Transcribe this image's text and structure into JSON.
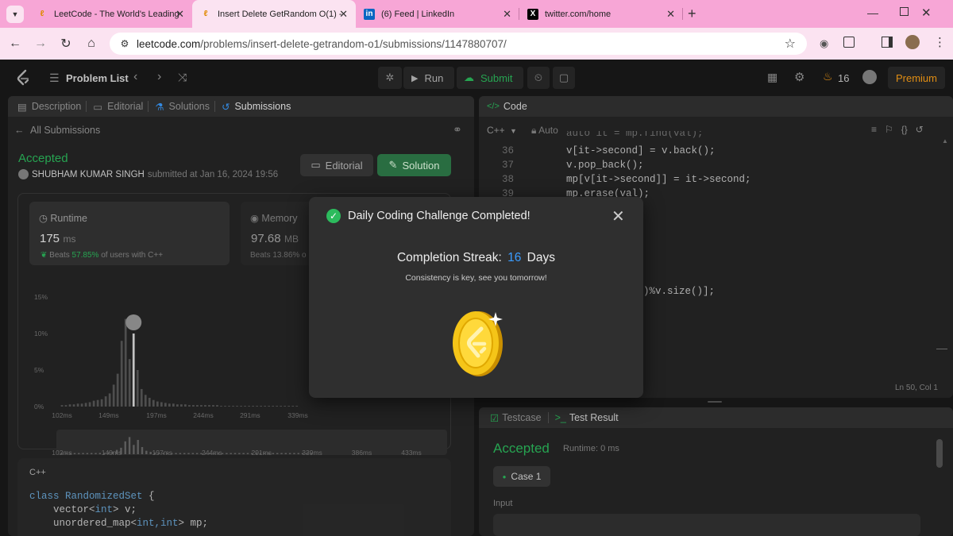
{
  "browser": {
    "tabs": [
      {
        "title": "LeetCode - The World's Leading",
        "favicon": "leetcode-icon"
      },
      {
        "title": "Insert Delete GetRandom O(1) -",
        "favicon": "leetcode-icon"
      },
      {
        "title": "(6) Feed | LinkedIn",
        "favicon": "linkedin-icon",
        "badge": "in"
      },
      {
        "title": "twitter.com/home",
        "favicon": "x-icon",
        "badge": "X"
      }
    ],
    "url_host": "leetcode.com",
    "url_path": "/problems/insert-delete-getrandom-o1/submissions/1147880707/"
  },
  "nav": {
    "problem_list": "Problem List",
    "run": "Run",
    "submit": "Submit",
    "streak_count": "16",
    "premium": "Premium"
  },
  "left": {
    "tabs": [
      "Description",
      "Editorial",
      "Solutions",
      "Submissions"
    ],
    "all_submissions": "All Submissions",
    "status": "Accepted",
    "author": "SHUBHAM KUMAR SINGH",
    "submitted_at": "submitted at Jan 16, 2024 19:56",
    "editorial_btn": "Editorial",
    "solution_btn": "Solution",
    "runtime": {
      "label": "Runtime",
      "value": "175",
      "unit": "ms",
      "beats_prefix": "Beats",
      "beats_value": "57.85%",
      "beats_suffix": "of users with C++"
    },
    "memory": {
      "label": "Memory",
      "value": "97.68",
      "unit": "MB",
      "beats": "Beats 13.86% o"
    },
    "y_ticks": [
      "15%",
      "10%",
      "5%",
      "0%"
    ],
    "x_ticks": [
      "102ms",
      "149ms",
      "197ms",
      "244ms",
      "291ms",
      "339ms"
    ],
    "mini_ticks": [
      "102ms",
      "149ms",
      "197ms",
      "244ms",
      "291ms",
      "339ms",
      "386ms",
      "433ms"
    ],
    "lang": "C++",
    "code": [
      {
        "a": "class ",
        "b": "RandomizedSet",
        "c": " {"
      },
      {
        "a": "    vector<",
        "b": "int",
        "c": "> v;"
      },
      {
        "a": "    unordered_map<",
        "b": "int,int",
        "c": "> mp;"
      }
    ]
  },
  "editor": {
    "title": "Code",
    "lang": "C++",
    "mode": "Auto",
    "lines": [
      {
        "n": "36",
        "t": "v[it->second] = v.back();"
      },
      {
        "n": "37",
        "t": "v.pop_back();"
      },
      {
        "n": "38",
        "t": "mp[v[it->second]] = it->second;"
      },
      {
        "n": "39",
        "t": "mp.erase(val);"
      }
    ],
    "partial_line": ")%v.size()];",
    "cursor": "Ln 50, Col 1"
  },
  "result": {
    "testcase_tab": "Testcase",
    "result_tab": "Test Result",
    "status": "Accepted",
    "runtime": "Runtime: 0 ms",
    "case": "Case 1",
    "input_label": "Input"
  },
  "modal": {
    "title": "Daily Coding Challenge Completed!",
    "streak_prefix": "Completion Streak:",
    "streak_value": "16",
    "streak_suffix": "Days",
    "message": "Consistency is key, see you tomorrow!"
  },
  "colors": {
    "accent_green": "#2cbb5d",
    "accent_blue": "#3b9cff",
    "coin": "#f5c518",
    "premium": "#ffa116"
  },
  "chart_data": {
    "type": "bar",
    "title": "",
    "xlabel": "",
    "ylabel": "",
    "ylim": [
      0,
      15
    ],
    "x": [
      102,
      106,
      110,
      114,
      118,
      122,
      126,
      130,
      134,
      138,
      142,
      146,
      150,
      154,
      158,
      162,
      166,
      170,
      174,
      178,
      182,
      186,
      190,
      194,
      198,
      202,
      206,
      210,
      214,
      218,
      222,
      226,
      230,
      234,
      238,
      242,
      246,
      250,
      254,
      258,
      262,
      266,
      270,
      274,
      278,
      282,
      286,
      290,
      294,
      298,
      302,
      306,
      310,
      314,
      318,
      322,
      326,
      330,
      334,
      338
    ],
    "values": [
      0.2,
      0.2,
      0.3,
      0.3,
      0.4,
      0.4,
      0.5,
      0.6,
      0.8,
      0.9,
      1.0,
      1.4,
      1.8,
      3.0,
      4.5,
      9.0,
      12.0,
      6.5,
      10.0,
      5.0,
      2.4,
      1.6,
      1.2,
      0.9,
      0.7,
      0.6,
      0.5,
      0.4,
      0.4,
      0.3,
      0.3,
      0.3,
      0.2,
      0.2,
      0.2,
      0.2,
      0.2,
      0.2,
      0.2,
      0.2,
      0.1,
      0.1,
      0.1,
      0.1,
      0.1,
      0.1,
      0.1,
      0.1,
      0.1,
      0.1,
      0.1,
      0.1,
      0.1,
      0.1,
      0.1,
      0.1,
      0.1,
      0.1,
      0.1,
      0.1
    ],
    "highlight_x": 174,
    "grid": false
  }
}
